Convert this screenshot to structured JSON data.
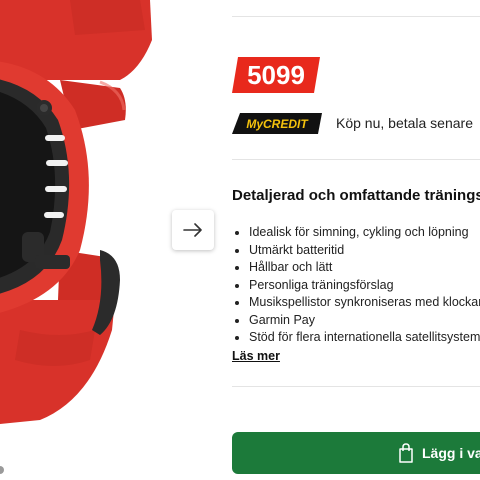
{
  "product": {
    "image_icon": "smartwatch-product-image",
    "band_color": "#d8322a"
  },
  "gallery": {
    "next_icon": "arrow-right-icon"
  },
  "price": {
    "value": "5099",
    "badge_color": "#e8291c"
  },
  "financing": {
    "logo": "MyCREDIT",
    "tagline": "Köp nu, betala senare"
  },
  "details": {
    "heading": "Detaljerad och omfattande träningss",
    "features": [
      "Idealisk för simning, cykling och löpning",
      "Utmärkt batteritid",
      "Hållbar och lätt",
      "Personliga träningsförslag",
      "Musikspellistor synkroniseras med klockan",
      "Garmin Pay",
      "Stöd för flera internationella satellitsystem"
    ],
    "read_more": "Läs mer"
  },
  "cart": {
    "label": "Lägg i va",
    "icon": "shopping-bag-icon",
    "color": "#1c7a3a"
  }
}
